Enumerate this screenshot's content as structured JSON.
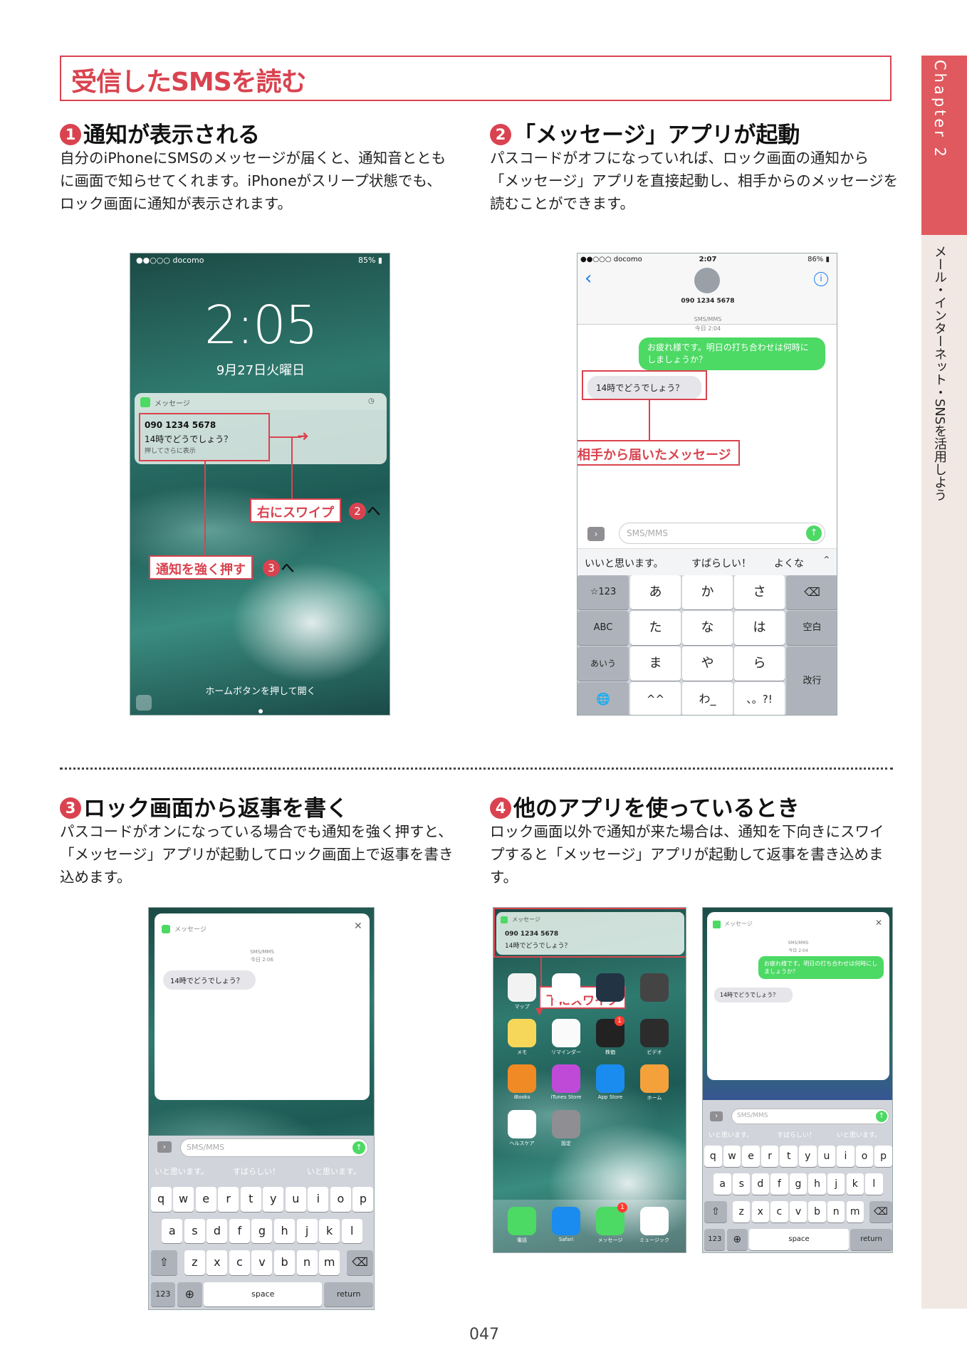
{
  "title": "受信したSMSを読む",
  "side": {
    "chapter": "Chapter 2",
    "section": "メール・インターネット・SNSを活用しよう"
  },
  "page_number": "047",
  "sections": [
    {
      "num": "1",
      "heading": "通知が表示される",
      "lines": [
        "自分のiPhoneにSMSのメッセージが届くと、通知音ととも",
        "に画面で知らせてくれます。iPhoneがスリープ状態でも、",
        "ロック画面に通知が表示されます。"
      ]
    },
    {
      "num": "2",
      "heading": "「メッセージ」アプリが起動",
      "lines": [
        "パスコードがオフになっていれば、ロック画面の通知から",
        "「メッセージ」アプリを直接起動し、相手からのメッセージを",
        "読むことができます。"
      ]
    },
    {
      "num": "3",
      "heading": "ロック画面から返事を書く",
      "lines": [
        "パスコードがオンになっている場合でも通知を強く押すと、",
        "「メッセージ」アプリが起動してロック画面上で返事を書き",
        "込めます。"
      ]
    },
    {
      "num": "4",
      "heading": "他のアプリを使っているとき",
      "lines": [
        "ロック画面以外で通知が来た場合は、通知を下向きにスワイ",
        "プすると「メッセージ」アプリが起動して返事を書き込めま",
        "す。"
      ]
    }
  ],
  "shot1": {
    "carrier": "●●○○○ docomo",
    "battery": "85%",
    "time": "2:05",
    "date": "9月27日火曜日",
    "app": "メッセージ",
    "sender": "090 1234 5678",
    "message": "14時でどうでしょう？",
    "hint": "押してさらに表示",
    "callout_swipe": "右にスワイプ",
    "callout_press": "通知を強く押す",
    "num_swipe": "2",
    "num_press": "3",
    "suffix": "へ",
    "home_text": "ホームボタンを押して開く"
  },
  "shot2": {
    "carrier": "●●○○○ docomo",
    "time": "2:07",
    "battery": "86%",
    "contact": "090 1234 5678",
    "service": "SMS/MMS",
    "timestamp": "今日 2:04",
    "sent": "お疲れ様です。明日の打ち合わせは何時にしましょうか？",
    "received": "14時でどうでしょう？",
    "callout": "相手から届いたメッセージ",
    "placeholder": "SMS/MMS",
    "suggestions": [
      "いいと思います。",
      "すばらしい！",
      "よくな"
    ],
    "keys_left": [
      "☆123",
      "ABC",
      "あいう",
      "🌐"
    ],
    "keys": [
      [
        "あ",
        "か",
        "さ"
      ],
      [
        "た",
        "な",
        "は"
      ],
      [
        "ま",
        "や",
        "ら"
      ],
      [
        "^^",
        "わ_",
        "、。?!"
      ]
    ],
    "key_space": "空白",
    "key_return": "改行"
  },
  "shot3": {
    "app": "メッセージ",
    "service": "SMS/MMS",
    "timestamp": "今日 2:06",
    "received": "14時でどうでしょう？",
    "placeholder": "SMS/MMS",
    "suggestions": [
      "いと思います。",
      "すばらしい！",
      "いと思います。"
    ],
    "row1": [
      "q",
      "w",
      "e",
      "r",
      "t",
      "y",
      "u",
      "i",
      "o",
      "p"
    ],
    "row2": [
      "a",
      "s",
      "d",
      "f",
      "g",
      "h",
      "j",
      "k",
      "l"
    ],
    "row3": [
      "z",
      "x",
      "c",
      "v",
      "b",
      "n",
      "m"
    ],
    "key_123": "123",
    "key_space": "space",
    "key_return": "return"
  },
  "shot4": {
    "app": "メッセージ",
    "sender": "090 1234 5678",
    "message": "14時でどうでしょう？",
    "callout": "下にスワイプ",
    "apps": [
      "マップ",
      "",
      "",
      "",
      "メモ",
      "リマインダー",
      "株価",
      "ビデオ",
      "iBooks",
      "iTunes Store",
      "App Store",
      "ホーム",
      "ヘルスケア",
      "設定"
    ],
    "dock": [
      "電話",
      "Safari",
      "メッセージ",
      "ミュージック"
    ],
    "badge": "1"
  },
  "shot5": {
    "app": "メッセージ",
    "service": "SMS/MMS",
    "timestamp": "今日 2:04",
    "sent": "お疲れ様です。明日の打ち合わせは何時にしましょうか？",
    "received": "14時でどうでしょう？",
    "placeholder": "SMS/MMS",
    "suggestions": [
      "いと思います。",
      "すばらしい！",
      "いと思います。"
    ],
    "row1": [
      "q",
      "w",
      "e",
      "r",
      "t",
      "y",
      "u",
      "i",
      "o",
      "p"
    ],
    "row2": [
      "a",
      "s",
      "d",
      "f",
      "g",
      "h",
      "j",
      "k",
      "l"
    ],
    "row3": [
      "z",
      "x",
      "c",
      "v",
      "b",
      "n",
      "m"
    ],
    "key_123": "123",
    "key_space": "space",
    "key_return": "return"
  }
}
